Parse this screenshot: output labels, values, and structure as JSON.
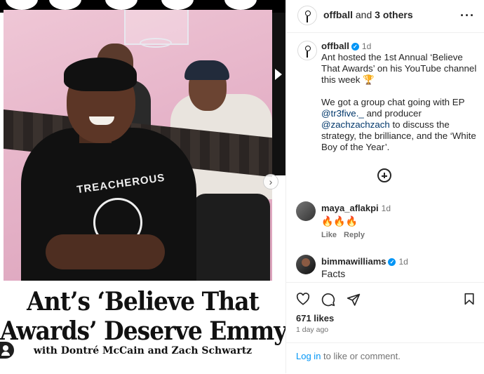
{
  "post": {
    "headline_line1": "Ant’s ‘Believe That",
    "headline_line2": "Awards’ Deserve Emmys",
    "byline": "with Dontré McCain and Zach Schwartz",
    "shirt_text": "TREACHEROUS"
  },
  "header": {
    "username": "offball",
    "and_text": " and ",
    "others": "3 others",
    "more_icon": "more-horizontal-icon"
  },
  "caption": {
    "username": "offball",
    "time": "1d",
    "line1": "Ant hosted the 1st Annual ‘Believe That Awards’ on his YouTube channel this week 🏆",
    "line2_pre": "We got a group chat going with EP ",
    "mention1": "@tr3five._",
    "line2_mid": " and producer ",
    "mention2": "@zachzachzach",
    "line2_post": " to discuss the strategy, the brilliance, and the ‘White Boy of the Year’."
  },
  "comments": [
    {
      "username": "maya_aflakpi",
      "time": "1d",
      "text": "🔥🔥🔥",
      "like_label": "Like",
      "reply_label": "Reply"
    },
    {
      "username": "bimmawilliams",
      "time": "1d",
      "text": "Facts",
      "verified": true
    }
  ],
  "actions": {
    "likes": "671 likes",
    "ago": "1 day ago",
    "login_link": "Log in",
    "login_rest": " to like or comment."
  },
  "colors": {
    "link": "#0095f6",
    "mention": "#00376b",
    "verified": "#0095f6",
    "secondary": "#737373"
  }
}
